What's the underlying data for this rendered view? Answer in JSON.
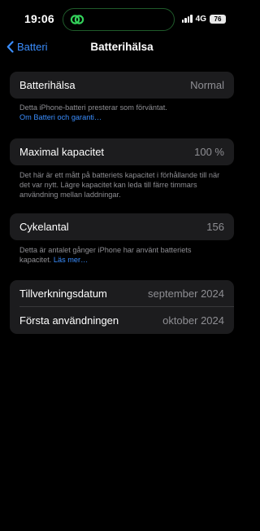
{
  "status_bar": {
    "time": "19:06",
    "network": "4G",
    "battery": "76"
  },
  "nav": {
    "back_label": "Batteri",
    "title": "Batterihälsa"
  },
  "battery_health": {
    "label": "Batterihälsa",
    "value": "Normal",
    "footer_text": "Detta iPhone-batteri presterar som förväntat.",
    "footer_link": "Om Batteri och garanti…"
  },
  "max_capacity": {
    "label": "Maximal kapacitet",
    "value": "100 %",
    "footer_text": "Det här är ett mått på batteriets kapacitet i förhållande till när det var nytt. Lägre kapacitet kan leda till färre timmars användning mellan laddningar."
  },
  "cycle_count": {
    "label": "Cykelantal",
    "value": "156",
    "footer_text": "Detta är antalet gånger iPhone har använt batteriets kapacitet.",
    "footer_link": "Läs mer…"
  },
  "dates": {
    "manufacture_label": "Tillverkningsdatum",
    "manufacture_value": "september 2024",
    "first_use_label": "Första användningen",
    "first_use_value": "oktober 2024"
  },
  "colors": {
    "accent": "#3a8dfd",
    "island_icon": "#33d05a",
    "cell_background": "#1c1c1e",
    "secondary_text": "#8e8e93"
  }
}
